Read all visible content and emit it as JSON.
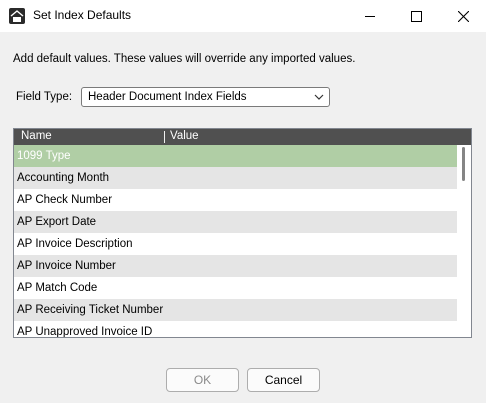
{
  "window": {
    "title": "Set Index Defaults",
    "icon": "app-logo-icon",
    "controls": [
      "minimize-icon",
      "maximize-icon",
      "close-icon"
    ]
  },
  "dialog": {
    "instructions": "Add default values. These values will override any imported values.",
    "field_type_label": "Field Type:",
    "field_type_value": "Header Document Index Fields"
  },
  "list": {
    "columns": {
      "name": "Name",
      "value": "Value"
    },
    "rows": [
      {
        "name": "1099 Type",
        "value": "",
        "selected": true
      },
      {
        "name": "Accounting Month",
        "value": ""
      },
      {
        "name": "AP Check Number",
        "value": ""
      },
      {
        "name": "AP Export Date",
        "value": ""
      },
      {
        "name": "AP Invoice Description",
        "value": ""
      },
      {
        "name": "AP Invoice Number",
        "value": ""
      },
      {
        "name": "AP Match Code",
        "value": ""
      },
      {
        "name": "AP Receiving Ticket Number",
        "value": ""
      },
      {
        "name": "AP Unapproved Invoice ID",
        "value": ""
      }
    ],
    "colors": {
      "header": "#505050",
      "selected": "#b0cea5",
      "alt_row": "#e5e5e5"
    }
  },
  "buttons": {
    "ok": "OK",
    "cancel": "Cancel"
  }
}
